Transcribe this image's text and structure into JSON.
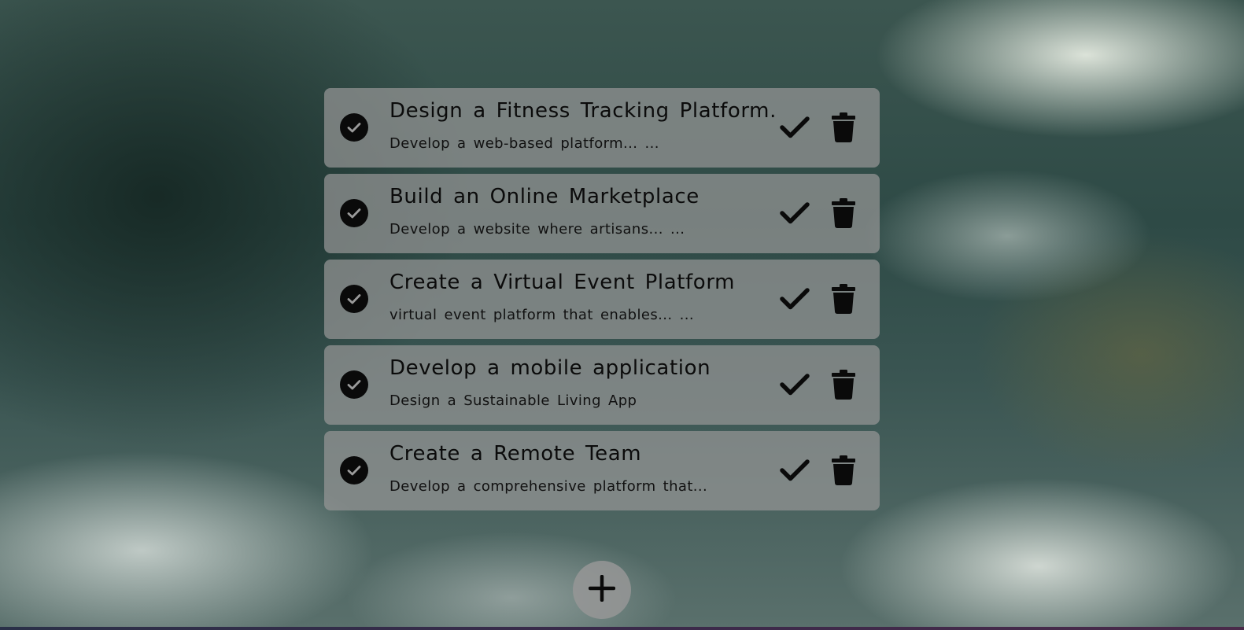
{
  "tasks": [
    {
      "title": "Design a Fitness Tracking Platform.",
      "description": "Develop a web-based platform... ...",
      "status_icon": "check-circle-icon",
      "complete_icon": "check-icon",
      "delete_icon": "trash-icon"
    },
    {
      "title": "Build an Online Marketplace",
      "description": "Develop a website where artisans... ...",
      "status_icon": "check-circle-icon",
      "complete_icon": "check-icon",
      "delete_icon": "trash-icon"
    },
    {
      "title": "Create a Virtual Event Platform",
      "description": "virtual event platform that enables... ...",
      "status_icon": "check-circle-icon",
      "complete_icon": "check-icon",
      "delete_icon": "trash-icon"
    },
    {
      "title": "Develop a mobile application",
      "description": "Design a Sustainable Living App",
      "status_icon": "check-circle-icon",
      "complete_icon": "check-icon",
      "delete_icon": "trash-icon"
    },
    {
      "title": "Create a Remote Team",
      "description": "Develop a comprehensive platform that...",
      "status_icon": "check-circle-icon",
      "complete_icon": "check-icon",
      "delete_icon": "trash-icon"
    }
  ],
  "add_button": {
    "icon": "plus-icon"
  },
  "colors": {
    "card_background": "#969696",
    "icon_color": "#0a0a0a",
    "text_color": "#0b0b0b"
  }
}
